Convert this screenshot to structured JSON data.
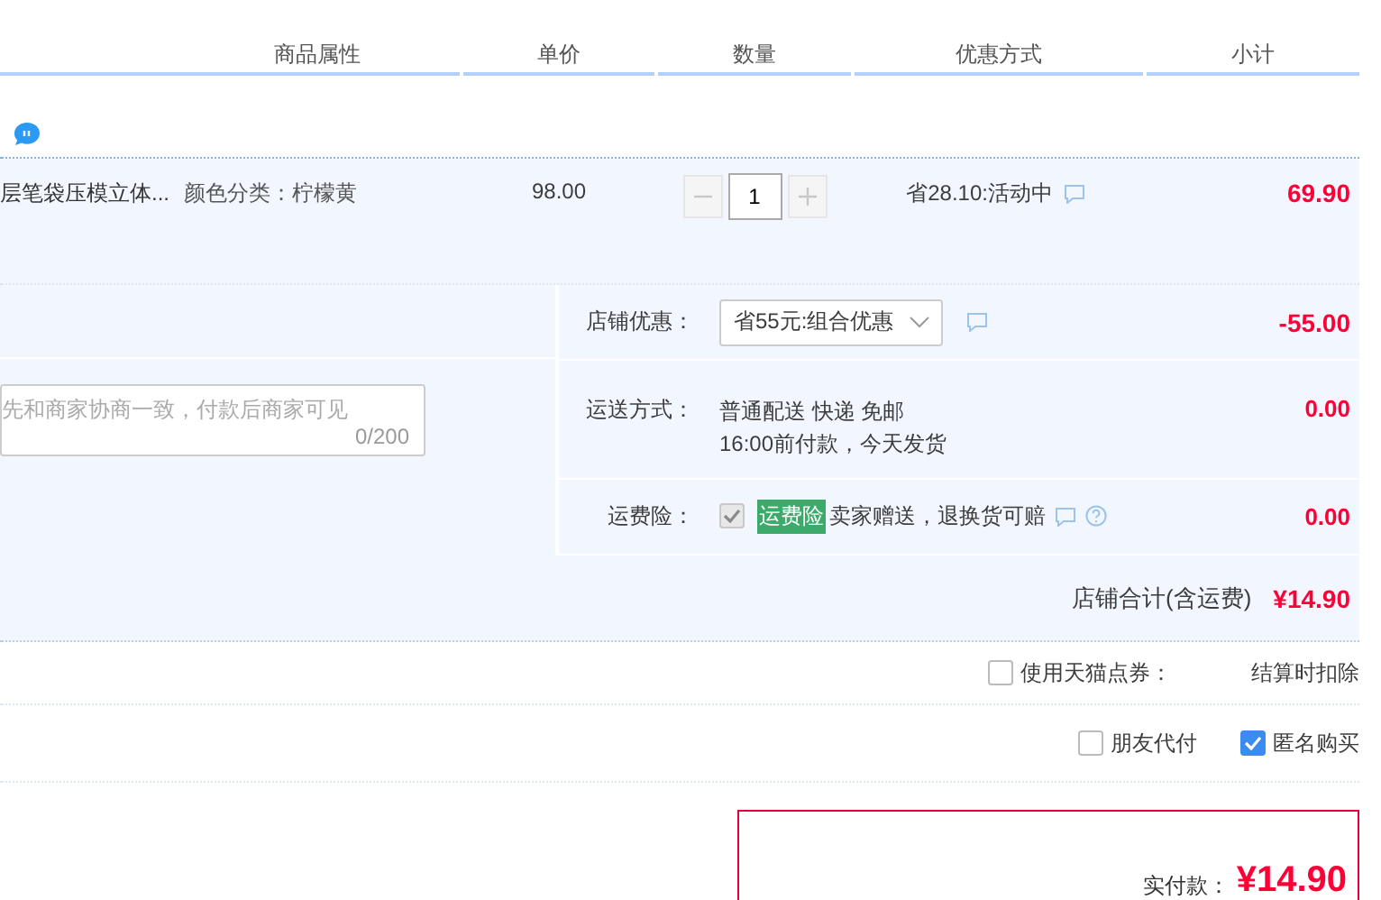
{
  "table": {
    "columns": [
      "商品属性",
      "单价",
      "数量",
      "优惠方式",
      "小计"
    ]
  },
  "items": [
    {
      "title": "层笔袋压模立体...",
      "attribute": "颜色分类：柠檬黄",
      "price": "98.00",
      "quantity": "1",
      "promotion": "省28.10:活动中",
      "subtotal": "69.90"
    }
  ],
  "message": {
    "placeholder": "先和商家协商一致，付款后商家可见",
    "counter": "0/200"
  },
  "shop_options": [
    {
      "kind": "select",
      "label": "店铺优惠：",
      "value": "省55元:组合优惠",
      "amount": "-55.00"
    },
    {
      "kind": "text",
      "label": "运送方式：",
      "lines": [
        "普通配送 快递 免邮",
        "16:00前付款，今天发货"
      ],
      "amount": "0.00"
    },
    {
      "kind": "insurance",
      "label": "运费险：",
      "checked": true,
      "disabled": true,
      "tag": "运费险",
      "text": "卖家赠送，退换货可赔",
      "amount": "0.00"
    }
  ],
  "shop_total": {
    "label": "店铺合计(含运费)",
    "amount": "¥14.90"
  },
  "coupon": {
    "label": "使用天猫点券：",
    "checked": false,
    "note": "结算时扣除"
  },
  "options": [
    {
      "label": "朋友代付",
      "checked": false
    },
    {
      "label": "匿名购买",
      "checked": true
    }
  ],
  "payment": {
    "label": "实付款：",
    "amount": "¥14.90"
  }
}
